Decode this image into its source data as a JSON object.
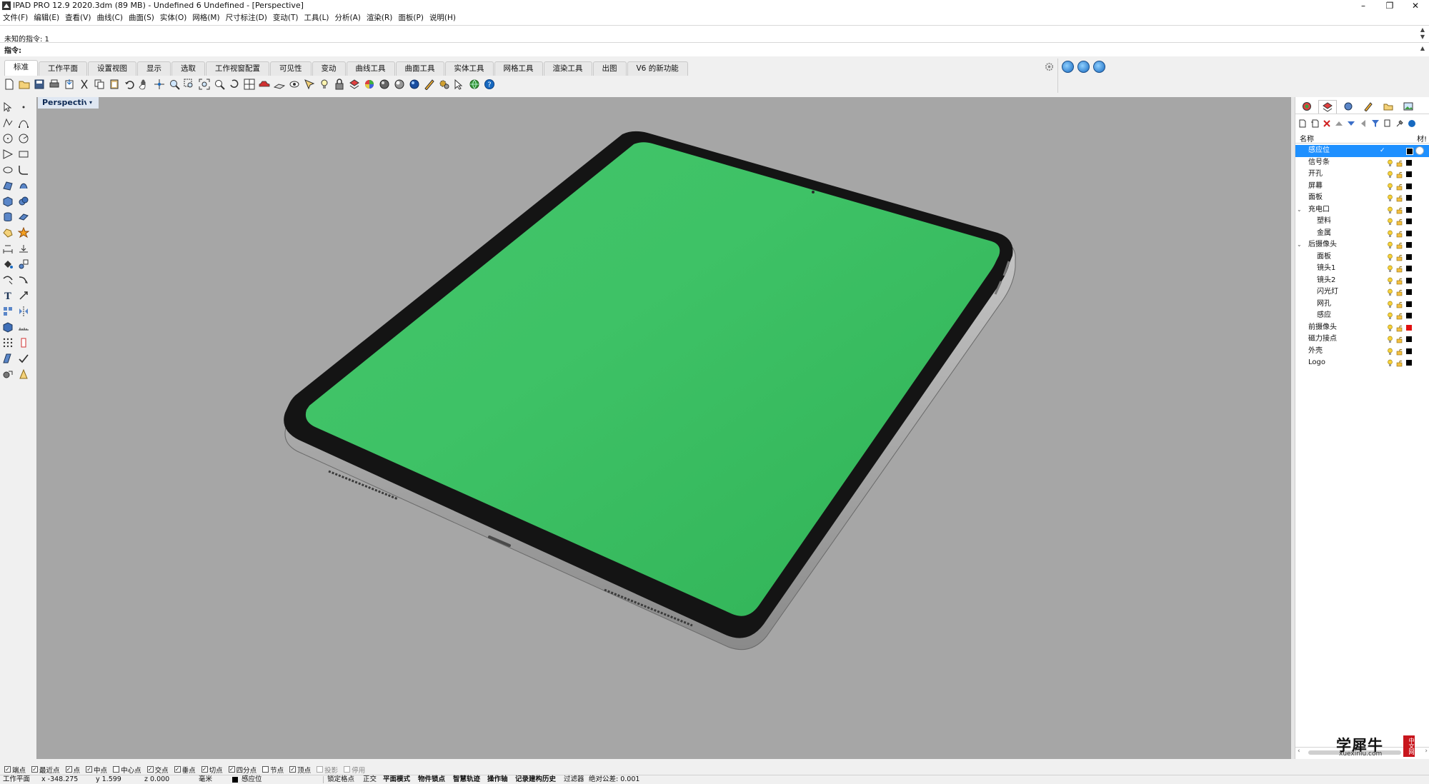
{
  "window": {
    "title": "IPAD PRO 12.9 2020.3dm (89 MB) - Undefined 6 Undefined - [Perspective]",
    "controls": {
      "minimize": "–",
      "restore": "❐",
      "close": "✕"
    }
  },
  "menu": [
    "文件(F)",
    "编辑(E)",
    "查看(V)",
    "曲线(C)",
    "曲面(S)",
    "实体(O)",
    "网格(M)",
    "尺寸标注(D)",
    "变动(T)",
    "工具(L)",
    "分析(A)",
    "渲染(R)",
    "面板(P)",
    "说明(H)"
  ],
  "command": {
    "history": "未知的指令: 1",
    "prompt": "指令:",
    "up_arrow": "▲",
    "down_arrow": "▼"
  },
  "tabs": [
    {
      "label": "标准",
      "active": true
    },
    {
      "label": "工作平面"
    },
    {
      "label": "设置视图"
    },
    {
      "label": "显示"
    },
    {
      "label": "选取"
    },
    {
      "label": "工作视窗配置"
    },
    {
      "label": "可见性"
    },
    {
      "label": "变动"
    },
    {
      "label": "曲线工具"
    },
    {
      "label": "曲面工具"
    },
    {
      "label": "实体工具"
    },
    {
      "label": "网格工具"
    },
    {
      "label": "渲染工具"
    },
    {
      "label": "出图"
    },
    {
      "label": "V6 的新功能"
    }
  ],
  "viewport": {
    "name": "Perspective",
    "dropdown_arrow": "▾"
  },
  "colors": {
    "screen": "#3cbf62",
    "bezel": "#141414",
    "body": "#b9b9b9",
    "viewport_bg": "#a6a6a6",
    "selection": "#1e90ff"
  },
  "layers": {
    "header_name": "名称",
    "header_material": "材!",
    "expand_symbol": "⌄",
    "current_check": "✓",
    "rows": [
      {
        "name": "感应位",
        "indent": 0,
        "selected": true,
        "color": "#000000"
      },
      {
        "name": "信号条",
        "indent": 0,
        "color": "#000000"
      },
      {
        "name": "开孔",
        "indent": 0,
        "color": "#000000"
      },
      {
        "name": "屏幕",
        "indent": 0,
        "color": "#000000"
      },
      {
        "name": "面板",
        "indent": 0,
        "color": "#000000"
      },
      {
        "name": "充电口",
        "indent": 0,
        "expanded": true,
        "color": "#000000"
      },
      {
        "name": "塑料",
        "indent": 1,
        "color": "#000000"
      },
      {
        "name": "金属",
        "indent": 1,
        "color": "#000000"
      },
      {
        "name": "后摄像头",
        "indent": 0,
        "expanded": true,
        "color": "#000000"
      },
      {
        "name": "面板",
        "indent": 1,
        "color": "#000000"
      },
      {
        "name": "镜头1",
        "indent": 1,
        "color": "#000000"
      },
      {
        "name": "镜头2",
        "indent": 1,
        "color": "#000000"
      },
      {
        "name": "闪光灯",
        "indent": 1,
        "color": "#000000"
      },
      {
        "name": "网孔",
        "indent": 1,
        "color": "#000000"
      },
      {
        "name": "感应",
        "indent": 1,
        "color": "#000000"
      },
      {
        "name": "前摄像头",
        "indent": 0,
        "color": "#e01010"
      },
      {
        "name": "磁力接点",
        "indent": 0,
        "color": "#000000"
      },
      {
        "name": "外壳",
        "indent": 0,
        "color": "#000000"
      },
      {
        "name": "Logo",
        "indent": 0,
        "color": "#000000"
      }
    ]
  },
  "scroll": {
    "left": "‹",
    "right": "›"
  },
  "watermark": {
    "text": "学犀牛",
    "url": "xuexiniu.com",
    "seal": "中文网"
  },
  "osnaps": [
    {
      "label": "端点",
      "checked": true
    },
    {
      "label": "最近点",
      "checked": true
    },
    {
      "label": "点",
      "checked": true
    },
    {
      "label": "中点",
      "checked": true
    },
    {
      "label": "中心点",
      "checked": false
    },
    {
      "label": "交点",
      "checked": true
    },
    {
      "label": "垂点",
      "checked": true
    },
    {
      "label": "切点",
      "checked": true
    },
    {
      "label": "四分点",
      "checked": true
    },
    {
      "label": "节点",
      "checked": false
    },
    {
      "label": "顶点",
      "checked": true
    },
    {
      "label": "投影",
      "checked": false,
      "disabled": true
    },
    {
      "label": "停用",
      "checked": false,
      "disabled": true
    }
  ],
  "status": {
    "cplane": "工作平面",
    "x": "x -348.275",
    "y": "y 1.599",
    "z": "z 0.000",
    "unit": "毫米",
    "layer": "感应位",
    "grid_snap": "锁定格点",
    "ortho": "正交",
    "planar": "平面模式",
    "osnap": "物件锁点",
    "smarttrack": "智慧轨迹",
    "gumball": "操作轴",
    "history": "记录建构历史",
    "filter": "过滤器",
    "tolerance": "绝对公差: 0.001"
  }
}
